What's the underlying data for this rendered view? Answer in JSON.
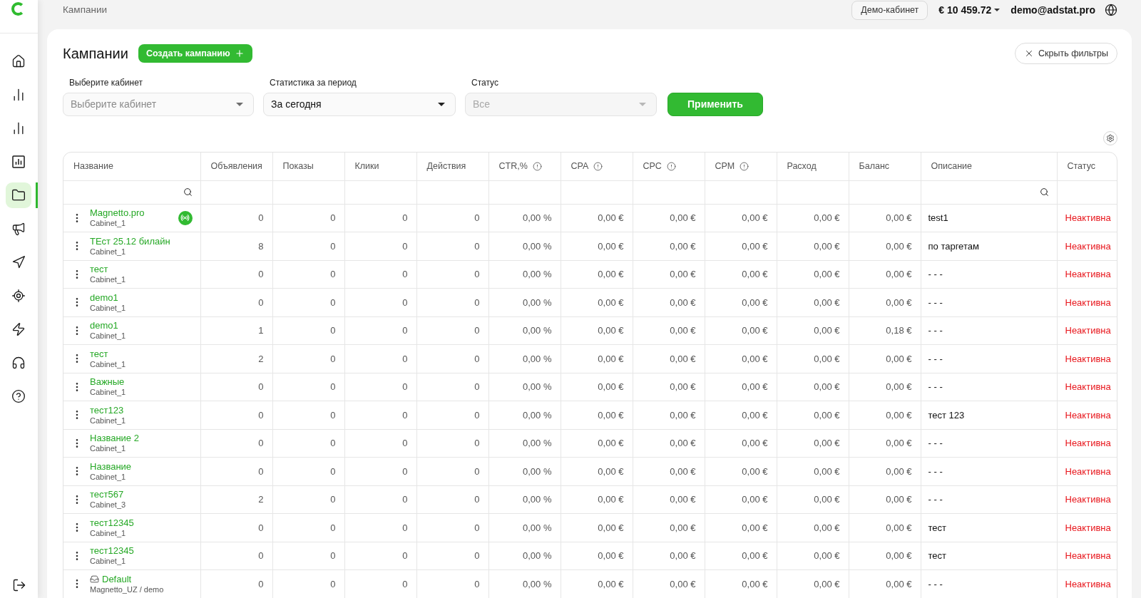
{
  "top_bar": {
    "breadcrumb": "Кампании",
    "account_button": "Демо-кабинет",
    "balance": "€ 10 459.72",
    "user_email": "demo@adstat.pro"
  },
  "sidebar": {
    "items": [
      {
        "selected": false
      },
      {
        "selected": false
      },
      {
        "selected": false
      },
      {
        "selected": false
      },
      {
        "selected": true
      },
      {
        "selected": false
      },
      {
        "selected": false
      },
      {
        "selected": false
      },
      {
        "selected": false
      },
      {
        "selected": false
      },
      {
        "selected": false
      }
    ]
  },
  "header": {
    "title": "Кампании",
    "create_button": "Создать кампанию",
    "hide_filters_button": "Скрыть фильтры"
  },
  "filters": {
    "fields": [
      {
        "label": "Выберите кабинет",
        "placeholder": "Выберите кабинет",
        "disabled": false
      },
      {
        "label": "Статистика за период",
        "value": "За сегодня",
        "disabled": false
      },
      {
        "label": "Статус",
        "placeholder": "Все",
        "disabled": true
      }
    ],
    "apply_button": "Применить"
  },
  "table": {
    "columns": [
      {
        "label": "Название",
        "searchable": true,
        "info": false
      },
      {
        "label": "Объявления",
        "searchable": false,
        "info": false
      },
      {
        "label": "Показы",
        "searchable": false,
        "info": false
      },
      {
        "label": "Клики",
        "searchable": false,
        "info": false
      },
      {
        "label": "Действия",
        "searchable": false,
        "info": false
      },
      {
        "label": "CTR,%",
        "searchable": false,
        "info": true
      },
      {
        "label": "CPA",
        "searchable": false,
        "info": true
      },
      {
        "label": "CPC",
        "searchable": false,
        "info": true
      },
      {
        "label": "CPM",
        "searchable": false,
        "info": true
      },
      {
        "label": "Расход",
        "searchable": false,
        "info": false
      },
      {
        "label": "Баланс",
        "searchable": false,
        "info": false
      },
      {
        "label": "Описание",
        "searchable": true,
        "info": false
      },
      {
        "label": "Статус",
        "searchable": false,
        "info": false
      }
    ],
    "rows": [
      {
        "active": false,
        "cells": [
          {
            "name": "Magnetto.pro",
            "cabinet": "Cabinet_1",
            "signal_badge": true,
            "tray_icon": false
          },
          "0",
          "0",
          "0",
          "0",
          "0,00 %",
          "0,00 €",
          "0,00 €",
          "0,00 €",
          "0,00 €",
          "0,00 €",
          "test1",
          "Неактивна"
        ]
      },
      {
        "active": false,
        "cells": [
          {
            "name": "ТЕст 25.12 билайн",
            "cabinet": "Cabinet_1",
            "signal_badge": false,
            "tray_icon": false
          },
          "8",
          "0",
          "0",
          "0",
          "0,00 %",
          "0,00 €",
          "0,00 €",
          "0,00 €",
          "0,00 €",
          "0,00 €",
          "по таргетам",
          "Неактивна"
        ]
      },
      {
        "active": false,
        "cells": [
          {
            "name": "тест",
            "cabinet": "Cabinet_1",
            "signal_badge": false,
            "tray_icon": false
          },
          "0",
          "0",
          "0",
          "0",
          "0,00 %",
          "0,00 €",
          "0,00 €",
          "0,00 €",
          "0,00 €",
          "0,00 €",
          "- - -",
          "Неактивна"
        ]
      },
      {
        "active": false,
        "cells": [
          {
            "name": "demo1",
            "cabinet": "Cabinet_1",
            "signal_badge": false,
            "tray_icon": false
          },
          "0",
          "0",
          "0",
          "0",
          "0,00 %",
          "0,00 €",
          "0,00 €",
          "0,00 €",
          "0,00 €",
          "0,00 €",
          "- - -",
          "Неактивна"
        ]
      },
      {
        "active": false,
        "cells": [
          {
            "name": "demo1",
            "cabinet": "Cabinet_1",
            "signal_badge": false,
            "tray_icon": false
          },
          "1",
          "0",
          "0",
          "0",
          "0,00 %",
          "0,00 €",
          "0,00 €",
          "0,00 €",
          "0,00 €",
          "0,18 €",
          "- - -",
          "Неактивна"
        ]
      },
      {
        "active": false,
        "cells": [
          {
            "name": "тест",
            "cabinet": "Cabinet_1",
            "signal_badge": false,
            "tray_icon": false
          },
          "2",
          "0",
          "0",
          "0",
          "0,00 %",
          "0,00 €",
          "0,00 €",
          "0,00 €",
          "0,00 €",
          "0,00 €",
          "- - -",
          "Неактивна"
        ]
      },
      {
        "active": false,
        "cells": [
          {
            "name": "Важные",
            "cabinet": "Cabinet_1",
            "signal_badge": false,
            "tray_icon": false
          },
          "0",
          "0",
          "0",
          "0",
          "0,00 %",
          "0,00 €",
          "0,00 €",
          "0,00 €",
          "0,00 €",
          "0,00 €",
          "- - -",
          "Неактивна"
        ]
      },
      {
        "active": false,
        "cells": [
          {
            "name": "тест123",
            "cabinet": "Cabinet_1",
            "signal_badge": false,
            "tray_icon": false
          },
          "0",
          "0",
          "0",
          "0",
          "0,00 %",
          "0,00 €",
          "0,00 €",
          "0,00 €",
          "0,00 €",
          "0,00 €",
          "тест 123",
          "Неактивна"
        ]
      },
      {
        "active": false,
        "cells": [
          {
            "name": "Название 2",
            "cabinet": "Cabinet_1",
            "signal_badge": false,
            "tray_icon": false
          },
          "0",
          "0",
          "0",
          "0",
          "0,00 %",
          "0,00 €",
          "0,00 €",
          "0,00 €",
          "0,00 €",
          "0,00 €",
          "- - -",
          "Неактивна"
        ]
      },
      {
        "active": false,
        "cells": [
          {
            "name": "Название",
            "cabinet": "Cabinet_1",
            "signal_badge": false,
            "tray_icon": false
          },
          "0",
          "0",
          "0",
          "0",
          "0,00 %",
          "0,00 €",
          "0,00 €",
          "0,00 €",
          "0,00 €",
          "0,00 €",
          "- - -",
          "Неактивна"
        ]
      },
      {
        "active": false,
        "cells": [
          {
            "name": "тест567",
            "cabinet": "Cabinet_3",
            "signal_badge": false,
            "tray_icon": false
          },
          "2",
          "0",
          "0",
          "0",
          "0,00 %",
          "0,00 €",
          "0,00 €",
          "0,00 €",
          "0,00 €",
          "0,00 €",
          "- - -",
          "Неактивна"
        ]
      },
      {
        "active": false,
        "cells": [
          {
            "name": "тест12345",
            "cabinet": "Cabinet_1",
            "signal_badge": false,
            "tray_icon": false
          },
          "0",
          "0",
          "0",
          "0",
          "0,00 %",
          "0,00 €",
          "0,00 €",
          "0,00 €",
          "0,00 €",
          "0,00 €",
          "тест",
          "Неактивна"
        ]
      },
      {
        "active": false,
        "cells": [
          {
            "name": "тест12345",
            "cabinet": "Cabinet_1",
            "signal_badge": false,
            "tray_icon": false
          },
          "0",
          "0",
          "0",
          "0",
          "0,00 %",
          "0,00 €",
          "0,00 €",
          "0,00 €",
          "0,00 €",
          "0,00 €",
          "тест",
          "Неактивна"
        ]
      },
      {
        "active": false,
        "cells": [
          {
            "name": "Default",
            "cabinet": "Magnetto_UZ / demo",
            "signal_badge": false,
            "tray_icon": true
          },
          "0",
          "0",
          "0",
          "0",
          "0,00 %",
          "0,00 €",
          "0,00 €",
          "0,00 €",
          "0,00 €",
          "0,00 €",
          "- - -",
          "Неактивна"
        ]
      }
    ]
  }
}
